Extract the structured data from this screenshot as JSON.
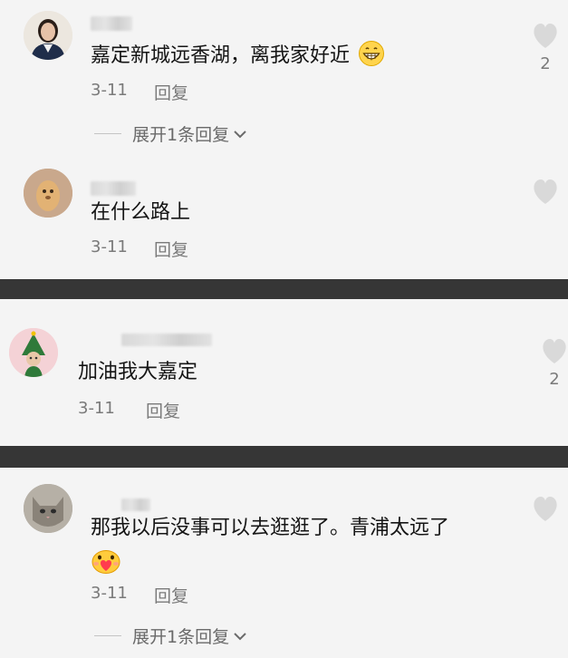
{
  "comments": [
    {
      "text": "嘉定新城远香湖，离我家好近",
      "emoji": "grinning-face",
      "date": "3-11",
      "reply_label": "回复",
      "like_count": "2",
      "expand_label": "展开1条回复"
    },
    {
      "text": "在什么路上",
      "date": "3-11",
      "reply_label": "回复",
      "like_count": ""
    },
    {
      "text": "加油我大嘉定",
      "date": "3-11",
      "reply_label": "回复",
      "like_count": "2"
    },
    {
      "text_line1": "那我以后没事可以去逛逛了。青浦太远了",
      "emoji": "face-with-heart",
      "date": "3-11",
      "reply_label": "回复",
      "like_count": "",
      "expand_label": "展开1条回复"
    }
  ],
  "colors": {
    "background": "#f4f4f4",
    "divider": "#363636",
    "secondary_text": "#7a7a7a",
    "heart": "#d9d9d9"
  }
}
